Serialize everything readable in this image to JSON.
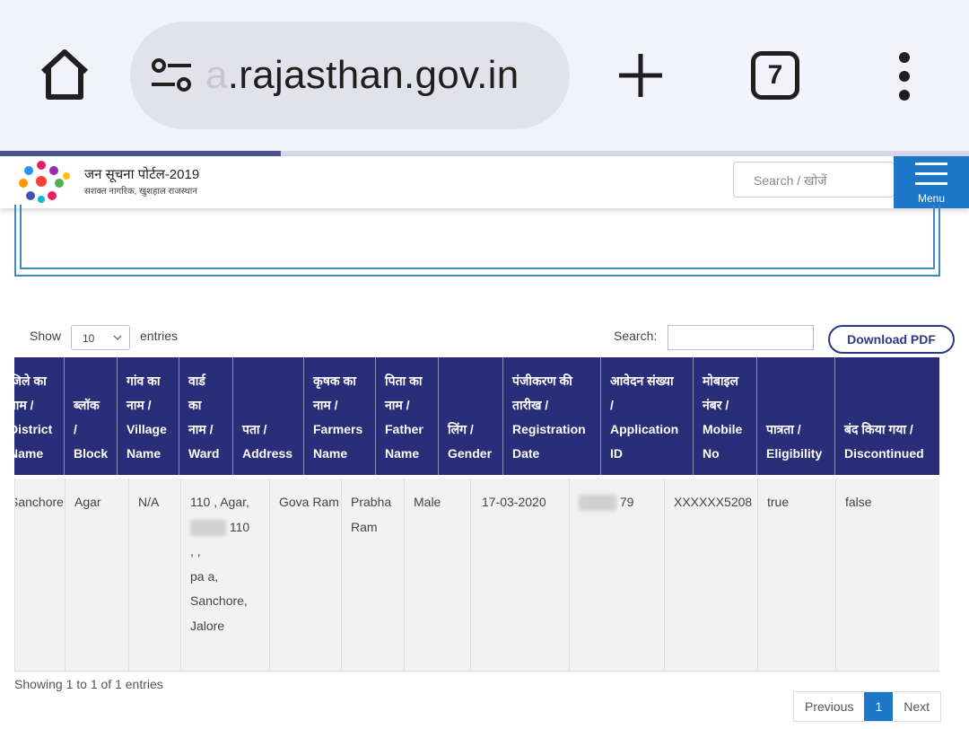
{
  "browser": {
    "url_faded": "a",
    "url": ".rajasthan.gov.in",
    "tab_count": "7"
  },
  "site": {
    "title": "जन सूचना पोर्टल-2019",
    "tagline": "सशक्त नागरिक, खुशहाल राजस्थान",
    "search_placeholder": "Search / खोजें",
    "menu_label": "Menu"
  },
  "controls": {
    "show_label": "Show",
    "entries_value": "10",
    "entries_label": "entries",
    "search_label": "Search:",
    "download_label": "Download PDF"
  },
  "table": {
    "headers": [
      [
        "जिले का",
        "नाम /",
        "District",
        "Name"
      ],
      [
        "ब्लॉक",
        "/",
        "Block"
      ],
      [
        "गांव का",
        "नाम /",
        "Village",
        "Name"
      ],
      [
        "वार्ड",
        "का",
        "नाम /",
        "Ward"
      ],
      [
        "पता /",
        "Address"
      ],
      [
        "कृषक का",
        "नाम /",
        "Farmers",
        "Name"
      ],
      [
        "पिता का",
        "नाम /",
        "Father",
        "Name"
      ],
      [
        "लिंग /",
        "Gender"
      ],
      [
        "पंजीकरण की",
        "तारीख /",
        "Registration",
        "Date"
      ],
      [
        "आवेदन संख्या",
        "/",
        "Application",
        "ID"
      ],
      [
        "मोबाइल",
        "नंबर /",
        "Mobile",
        "No"
      ],
      [
        "पात्रता /",
        "Eligibility"
      ],
      [
        "बंद किया गया /",
        "Discontinued"
      ]
    ],
    "row": {
      "district": "Sanchore",
      "block": "Agar",
      "village": "N/A",
      "ward_address_1": "110 , Agar,",
      "ward_address_2": "110",
      "ward_address_3": ", ,",
      "ward_address_4": "pa a,",
      "ward_address_5": "Sanchore,",
      "ward_address_6": "Jalore",
      "farmer": "Gova Ram",
      "father": "Prabha Ram",
      "gender": "Male",
      "date": "17-03-2020",
      "app_id_suffix": "79",
      "mobile": "XXXXXX5208",
      "eligibility": "true",
      "discontinued": "false"
    }
  },
  "footer": {
    "info": "Showing 1 to 1 of 1 entries",
    "prev": "Previous",
    "page": "1",
    "next": "Next"
  },
  "colors": {
    "header_bg": "#2a2e78",
    "accent": "#1d77c8"
  }
}
